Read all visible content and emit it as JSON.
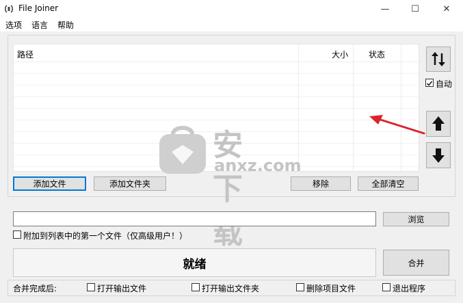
{
  "window": {
    "title": "File Joiner",
    "minimize": "—",
    "maximize": "☐",
    "close": "✕"
  },
  "menu": [
    {
      "label": "选项"
    },
    {
      "label": "语言"
    },
    {
      "label": "帮助"
    }
  ],
  "file_list": {
    "columns": [
      {
        "label": "路径"
      },
      {
        "label": "大小"
      },
      {
        "label": "状态"
      }
    ],
    "rows": []
  },
  "list_buttons": {
    "add_file": "添加文件",
    "add_folder": "添加文件夹",
    "remove": "移除",
    "clear_all": "全部清空"
  },
  "side_controls": {
    "auto_label": "自动",
    "auto_checked": true
  },
  "output": {
    "path_value": "",
    "browse": "浏览",
    "append_label": "附加到列表中的第一个文件（仅高级用户！）",
    "append_checked": false
  },
  "status": {
    "text": "就绪",
    "merge": "合并"
  },
  "after_merge": {
    "label": "合并完成后:",
    "options": [
      {
        "label": "打开输出文件",
        "checked": false
      },
      {
        "label": "打开输出文件夹",
        "checked": false
      },
      {
        "label": "删除项目文件",
        "checked": false
      },
      {
        "label": "退出程序",
        "checked": false
      }
    ]
  },
  "watermark": {
    "text": "安下载",
    "domain": "anxz.com"
  },
  "colors": {
    "accent": "#0078d7",
    "annotation_arrow": "#d9252a"
  }
}
